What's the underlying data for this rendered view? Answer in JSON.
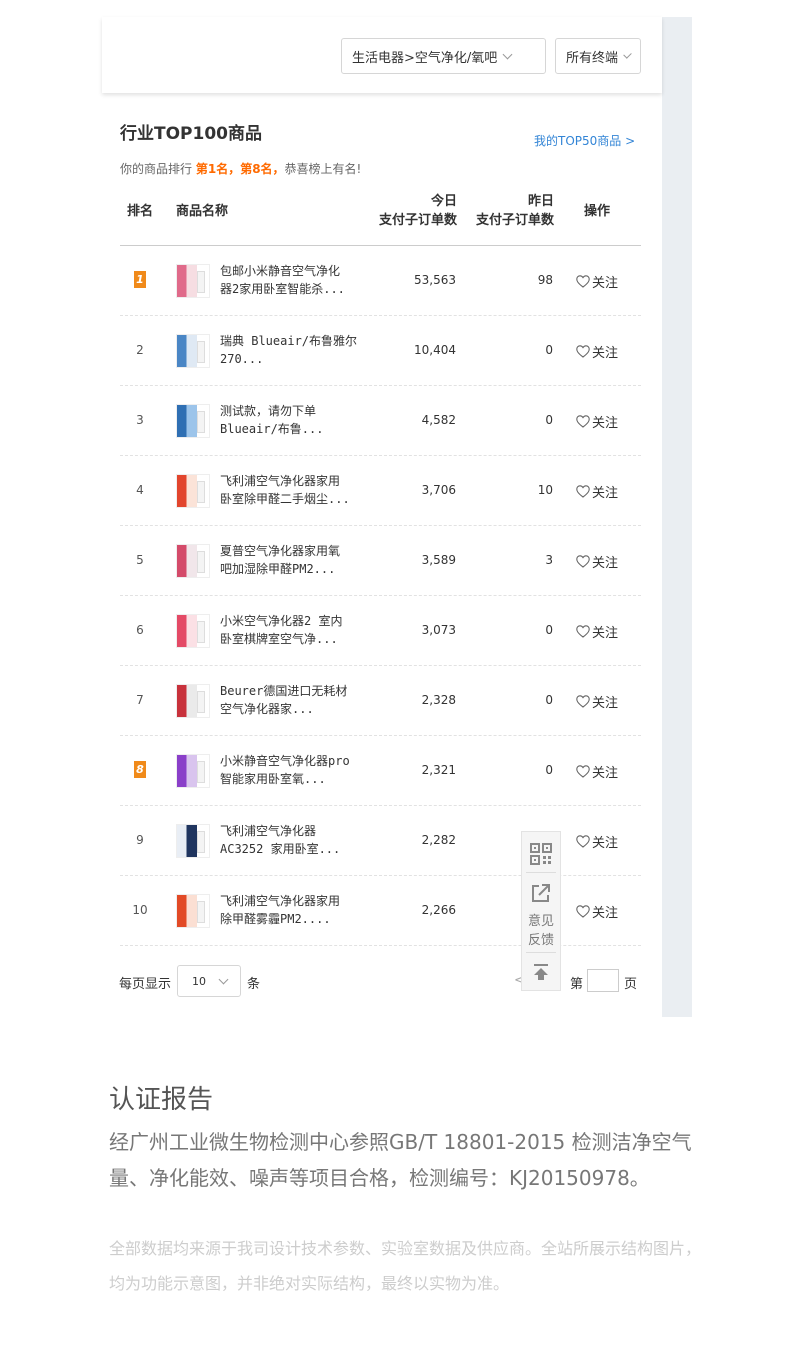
{
  "filters": {
    "category": "生活电器>空气净化/氧吧",
    "terminal": "所有终端"
  },
  "panel": {
    "title": "行业TOP100商品",
    "my_top50": "我的TOP50商品 >",
    "rank_note_prefix": "你的商品排行",
    "rank_note_highlight": "第1名，第8名，",
    "rank_note_suffix": "恭喜榜上有名!"
  },
  "table": {
    "headers": {
      "rank": "排名",
      "name": "商品名称",
      "today_l1": "今日",
      "today_l2": "支付子订单数",
      "yesterday_l1": "昨日",
      "yesterday_l2": "支付子订单数",
      "action": "操作"
    },
    "follow_label": "关注",
    "rows": [
      {
        "rank": "1",
        "badge": true,
        "name1": "包邮小米静音空气净化",
        "name2": "器2家用卧室智能杀...",
        "today": "53,563",
        "yesterday": "98",
        "thumb_colors": [
          "#f6dde2",
          "#e06a8a"
        ]
      },
      {
        "rank": "2",
        "badge": false,
        "name1": "瑞典 Blueair/布鲁雅尔",
        "name2": "270...",
        "today": "10,404",
        "yesterday": "0",
        "thumb_colors": [
          "#dfe9f4",
          "#4a86c5"
        ]
      },
      {
        "rank": "3",
        "badge": false,
        "name1": "测试款，请勿下单",
        "name2": "Blueair/布鲁...",
        "today": "4,582",
        "yesterday": "0",
        "thumb_colors": [
          "#9cc4ea",
          "#2f6fb3"
        ]
      },
      {
        "rank": "4",
        "badge": false,
        "name1": "飞利浦空气净化器家用",
        "name2": "卧室除甲醛二手烟尘...",
        "today": "3,706",
        "yesterday": "10",
        "thumb_colors": [
          "#fbe3d8",
          "#e2452d"
        ]
      },
      {
        "rank": "5",
        "badge": false,
        "name1": "夏普空气净化器家用氧",
        "name2": "吧加湿除甲醛PM2...",
        "today": "3,589",
        "yesterday": "3",
        "thumb_colors": [
          "#f1e6ea",
          "#d44b6a"
        ]
      },
      {
        "rank": "6",
        "badge": false,
        "name1": "小米空气净化器2 室内",
        "name2": "卧室棋牌室空气净...",
        "today": "3,073",
        "yesterday": "0",
        "thumb_colors": [
          "#fbe0e5",
          "#e44a66"
        ]
      },
      {
        "rank": "7",
        "badge": false,
        "name1": "Beurer德国进口无耗材",
        "name2": "空气净化器家...",
        "today": "2,328",
        "yesterday": "0",
        "thumb_colors": [
          "#eaeaea",
          "#c8323c"
        ]
      },
      {
        "rank": "8",
        "badge": true,
        "name1": "小米静音空气净化器pro",
        "name2": "智能家用卧室氧...",
        "today": "2,321",
        "yesterday": "0",
        "thumb_colors": [
          "#d9c4ee",
          "#8a3fc9"
        ]
      },
      {
        "rank": "9",
        "badge": false,
        "name1": "飞利浦空气净化器",
        "name2": "AC3252 家用卧室...",
        "today": "2,282",
        "yesterday": "",
        "thumb_colors": [
          "#20355f",
          "#e9eef5"
        ]
      },
      {
        "rank": "10",
        "badge": false,
        "name1": "飞利浦空气净化器家用",
        "name2": "除甲醛雾霾PM2....",
        "today": "2,266",
        "yesterday": "",
        "thumb_colors": [
          "#fbdfd3",
          "#e24a26"
        ]
      }
    ]
  },
  "pagination": {
    "per_page_label": "每页显示",
    "per_page_value": "10",
    "per_page_unit": "条",
    "prev": "<",
    "page_prefix": "第",
    "page_suffix": "页"
  },
  "float_bar": {
    "feedback_l1": "意见",
    "feedback_l2": "反馈",
    "icons": [
      "qr-code-icon",
      "share-icon",
      "back-to-top-icon"
    ]
  },
  "certification": {
    "title": "认证报告",
    "body": "经广州工业微生物检测中心参照GB/T 18801-2015 检测洁净空气量、净化能效、噪声等项目合格，检测编号：KJ20150978。",
    "note": "全部数据均来源于我司设计技术参数、实验室数据及供应商。全站所展示结构图片，均为功能示意图，并非绝对实际结构，最终以实物为准。"
  },
  "colors": {
    "accent_orange": "#ff6a00",
    "link_blue": "#3385d6",
    "badge_orange": "#f08a1a"
  }
}
